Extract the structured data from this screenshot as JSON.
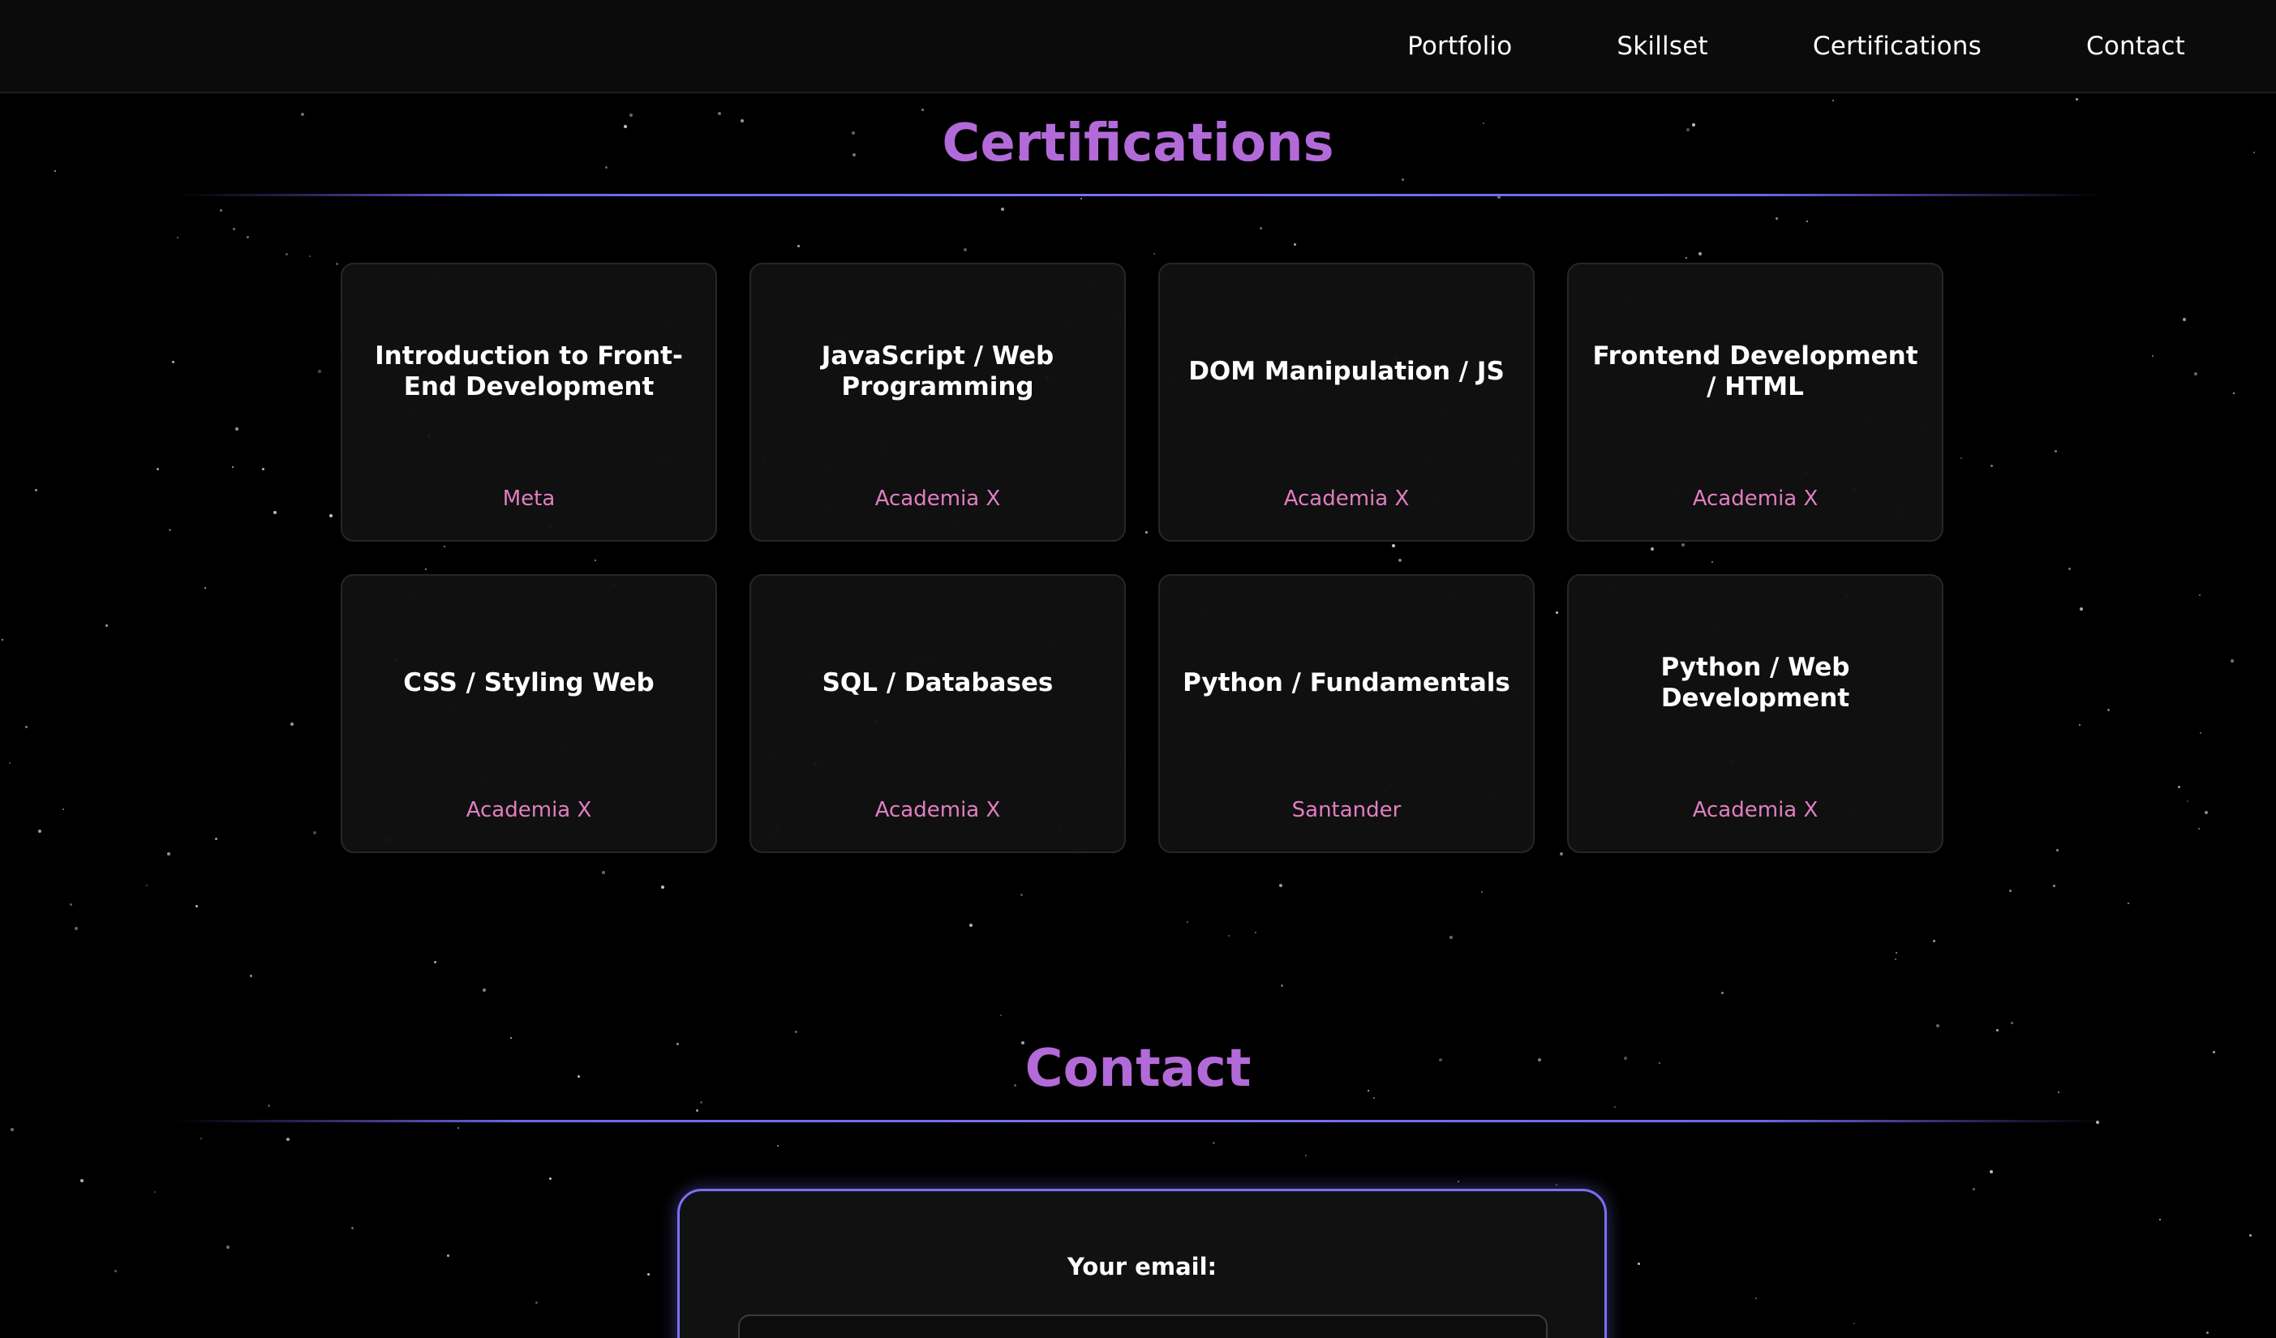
{
  "nav": {
    "links": [
      "Portfolio",
      "Skillset",
      "Certifications",
      "Contact"
    ]
  },
  "certifications": {
    "title": "Certifications",
    "items": [
      {
        "title": "Introduction to Front-End Development",
        "issuer": "Meta"
      },
      {
        "title": "JavaScript / Web Programming",
        "issuer": "Academia X"
      },
      {
        "title": "DOM Manipulation / JS",
        "issuer": "Academia X"
      },
      {
        "title": "Frontend Development / HTML",
        "issuer": "Academia X"
      },
      {
        "title": "CSS / Styling Web",
        "issuer": "Academia X"
      },
      {
        "title": "SQL / Databases",
        "issuer": "Academia X"
      },
      {
        "title": "Python / Fundamentals",
        "issuer": "Santander"
      },
      {
        "title": "Python / Web Development",
        "issuer": "Academia X"
      }
    ]
  },
  "contact": {
    "title": "Contact",
    "email_label": "Your email:",
    "email_value": "",
    "email_placeholder": ""
  },
  "colors": {
    "accent_purple": "#b36ad9",
    "divider_blue": "#7b6ff5",
    "issuer_pink": "#e07fc1",
    "background": "#000000",
    "card_background": "#111111"
  }
}
